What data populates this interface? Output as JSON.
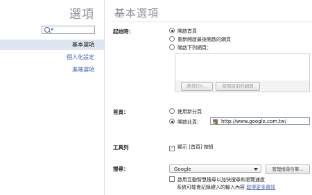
{
  "sidebar": {
    "title": "選項",
    "items": [
      {
        "label": "基本選項",
        "active": true
      },
      {
        "label": "個人化設定",
        "active": false
      },
      {
        "label": "進階選項",
        "active": false
      }
    ]
  },
  "main": {
    "title": "基本選項",
    "startup": {
      "label": "起始時：",
      "options": [
        "開啟首頁",
        "重新開啟最後開啟的網頁",
        "開啟下列網頁："
      ],
      "selected": 0,
      "add_button": "新增(D)...",
      "use_current_button": "使用目前的網頁"
    },
    "homepage": {
      "label": "首頁：",
      "options": [
        "使用新分頁",
        "開啟此頁："
      ],
      "selected": 1,
      "url": "http://www.google.com.tw/"
    },
    "toolbar": {
      "label": "工具列",
      "show_home_label": "顯示 [首頁] 按鈕",
      "checked": true
    },
    "search": {
      "label": "搜尋：",
      "engine": "Google",
      "manage_button": "管理搜尋引擎...",
      "instant_label": "啟用互動智慧搜尋以加快搜尋和瀏覽速度",
      "instant_note": "系統可能會記錄鍵入的輸入內容",
      "learn_more": "取得更多資訊"
    }
  }
}
